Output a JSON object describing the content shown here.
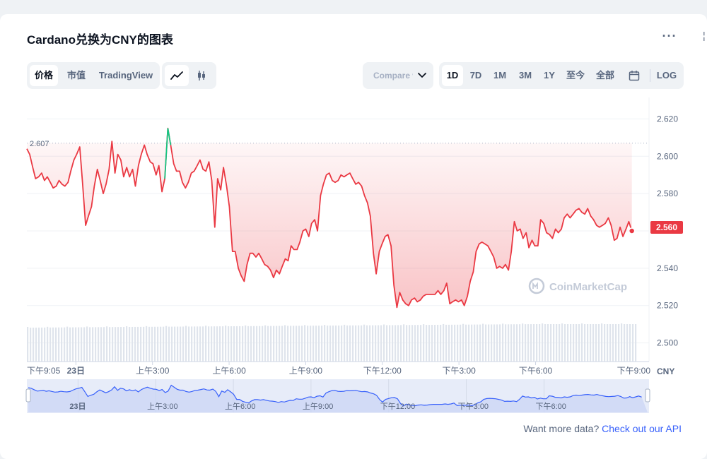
{
  "title": "Cardano兑换为CNY的图表",
  "tabs": [
    {
      "label": "价格",
      "active": true
    },
    {
      "label": "市值",
      "active": false
    },
    {
      "label": "TradingView",
      "active": false
    }
  ],
  "chart_types": [
    {
      "icon": "line-chart-icon",
      "active": true
    },
    {
      "icon": "candlestick-icon",
      "active": false
    }
  ],
  "compare": {
    "label": "Compare with"
  },
  "ranges": [
    {
      "label": "1D",
      "active": true
    },
    {
      "label": "7D",
      "active": false
    },
    {
      "label": "1M",
      "active": false
    },
    {
      "label": "3M",
      "active": false
    },
    {
      "label": "1Y",
      "active": false
    },
    {
      "label": "至今",
      "active": false
    },
    {
      "label": "全部",
      "active": false
    }
  ],
  "log_label": "LOG",
  "watermark": "CoinMarketCap",
  "footer": {
    "text": "Want more data? ",
    "link": "Check out our API"
  },
  "colors": {
    "down": "#ea3943",
    "up": "#16c784",
    "navigator": "#3861fb",
    "volume": "#cfd6e4",
    "axis": "#58667e"
  },
  "chart_data": {
    "type": "line",
    "currency": "CNY",
    "open_price": "2.607",
    "last_price": "2.560",
    "ylim": [
      2.49,
      2.63
    ],
    "yticks": [
      "2.620",
      "2.600",
      "2.580",
      "2.560",
      "2.540",
      "2.520",
      "2.500"
    ],
    "xticks": [
      "下午9:05",
      "23日",
      "上午3:00",
      "上午6:00",
      "上午9:00",
      "下午12:00",
      "下午3:00",
      "下午6:00",
      "下午9:00"
    ],
    "navigator_ticks": [
      "23日",
      "上午3:00",
      "上午6:00",
      "上午9:00",
      "下午12:00",
      "下午3:00",
      "下午6:00"
    ],
    "grid": true,
    "x_hours": [
      0,
      0.11,
      0.23,
      0.34,
      0.46,
      0.58,
      0.69,
      0.8,
      0.92,
      1.03,
      1.15,
      1.26,
      1.38,
      1.49,
      1.61,
      1.72,
      1.84,
      1.95,
      2.07,
      2.18,
      2.3,
      2.41,
      2.53,
      2.64,
      2.76,
      2.87,
      2.99,
      3.1,
      3.22,
      3.33,
      3.45,
      3.56,
      3.68,
      3.79,
      3.91,
      4.02,
      4.14,
      4.25,
      4.37,
      4.48,
      4.6,
      4.71,
      4.83,
      4.94,
      5.06,
      5.17,
      5.29,
      5.4,
      5.52,
      5.63,
      5.75,
      5.86,
      5.98,
      6.09,
      6.21,
      6.32,
      6.44,
      6.55,
      6.67,
      6.78,
      6.9,
      7.01,
      7.13,
      7.24,
      7.36,
      7.47,
      7.59,
      7.7,
      7.82,
      7.93,
      8.05,
      8.16,
      8.28,
      8.39,
      8.51,
      8.62,
      8.74,
      8.85,
      8.97,
      9.08,
      9.2,
      9.31,
      9.43,
      9.54,
      9.66,
      9.77,
      9.89,
      10.0,
      10.12,
      10.23,
      10.35,
      10.46,
      10.58,
      10.69,
      10.81,
      10.92,
      11.04,
      11.15,
      11.27,
      11.38,
      11.5,
      11.61,
      11.73,
      11.84,
      11.96,
      12.07,
      12.19,
      12.3,
      12.42,
      12.53,
      12.65,
      12.76,
      12.88,
      12.99,
      13.11,
      13.22,
      13.34,
      13.45,
      13.57,
      13.68,
      13.8,
      13.91,
      14.03,
      14.14,
      14.26,
      14.37,
      14.49,
      14.6,
      14.72,
      14.83,
      14.95,
      15.06,
      15.18,
      15.29,
      15.41,
      15.52,
      15.64,
      15.75,
      15.87,
      15.98,
      16.1,
      16.21,
      16.33,
      16.44,
      16.56,
      16.67,
      16.79,
      16.9,
      17.02,
      17.13,
      17.25,
      17.36,
      17.48,
      17.59,
      17.71,
      17.82,
      17.94,
      18.05,
      18.17,
      18.28,
      18.4,
      18.51,
      18.63,
      18.74,
      18.86,
      18.97,
      19.09,
      19.2,
      19.32,
      19.43,
      19.55,
      19.66,
      19.78,
      19.89,
      20.01,
      20.12,
      20.24,
      20.35,
      20.47,
      20.58,
      20.7,
      20.81,
      20.93,
      21.04,
      21.16,
      21.27,
      21.39,
      21.5,
      21.62,
      21.73,
      21.85,
      21.96,
      22.08,
      22.19,
      22.31,
      22.42,
      22.54,
      22.65,
      22.77,
      22.88,
      23.0,
      23.11,
      23.23,
      23.34,
      23.46,
      23.57,
      23.69,
      23.8,
      23.92
    ],
    "prices": [
      2.604,
      2.601,
      2.594,
      2.588,
      2.589,
      2.591,
      2.587,
      2.589,
      2.586,
      2.583,
      2.584,
      2.587,
      2.585,
      2.584,
      2.586,
      2.592,
      2.598,
      2.601,
      2.605,
      2.586,
      2.563,
      2.568,
      2.573,
      2.584,
      2.593,
      2.587,
      2.58,
      2.585,
      2.593,
      2.608,
      2.591,
      2.601,
      2.598,
      2.589,
      2.594,
      2.589,
      2.593,
      2.584,
      2.595,
      2.601,
      2.606,
      2.601,
      2.597,
      2.596,
      2.59,
      2.595,
      2.581,
      2.588,
      2.615,
      2.606,
      2.596,
      2.592,
      2.592,
      2.586,
      2.583,
      2.586,
      2.591,
      2.592,
      2.595,
      2.598,
      2.593,
      2.592,
      2.597,
      2.587,
      2.562,
      2.588,
      2.582,
      2.594,
      2.584,
      2.573,
      2.549,
      2.549,
      2.54,
      2.536,
      2.533,
      2.542,
      2.548,
      2.548,
      2.546,
      2.548,
      2.545,
      2.542,
      2.541,
      2.539,
      2.535,
      2.539,
      2.537,
      2.541,
      2.545,
      2.544,
      2.552,
      2.55,
      2.55,
      2.554,
      2.56,
      2.561,
      2.557,
      2.564,
      2.566,
      2.56,
      2.579,
      2.585,
      2.59,
      2.591,
      2.587,
      2.586,
      2.587,
      2.59,
      2.589,
      2.59,
      2.591,
      2.588,
      2.585,
      2.586,
      2.584,
      2.579,
      2.575,
      2.568,
      2.548,
      2.537,
      2.549,
      2.553,
      2.557,
      2.558,
      2.552,
      2.531,
      2.519,
      2.527,
      2.523,
      2.521,
      2.52,
      2.523,
      2.524,
      2.522,
      2.523,
      2.525,
      2.526,
      2.526,
      2.526,
      2.526,
      2.528,
      2.526,
      2.528,
      2.532,
      2.521,
      2.522,
      2.523,
      2.522,
      2.523,
      2.52,
      2.525,
      2.533,
      2.538,
      2.549,
      2.553,
      2.554,
      2.553,
      2.552,
      2.549,
      2.546,
      2.54,
      2.541,
      2.54,
      2.542,
      2.539,
      2.549,
      2.565,
      2.56,
      2.561,
      2.556,
      2.559,
      2.551,
      2.555,
      2.552,
      2.552,
      2.566,
      2.564,
      2.559,
      2.558,
      2.556,
      2.561,
      2.559,
      2.561,
      2.567,
      2.569,
      2.567,
      2.569,
      2.571,
      2.572,
      2.57,
      2.569,
      2.572,
      2.568,
      2.566,
      2.563,
      2.562,
      2.563,
      2.564,
      2.567,
      2.563,
      2.555,
      2.556,
      2.562,
      2.557,
      2.561,
      2.565,
      2.56
    ]
  }
}
